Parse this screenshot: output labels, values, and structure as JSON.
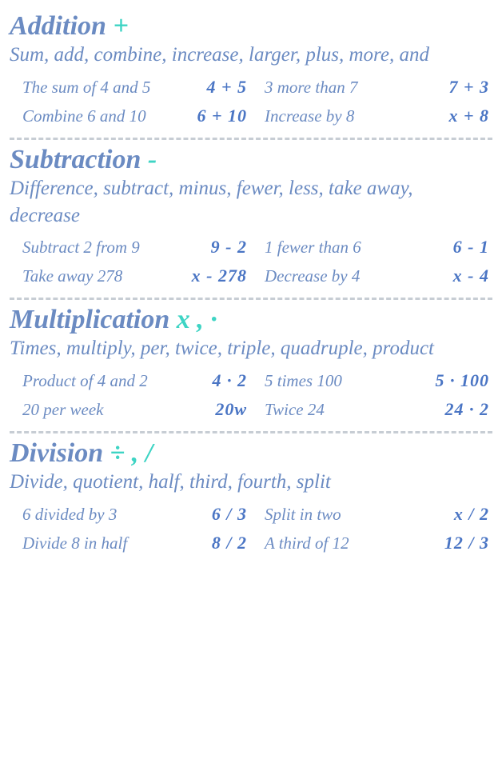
{
  "sections": [
    {
      "title": "Addition",
      "symbol": "+",
      "description": "Sum, add, combine, increase, larger, plus, more, and",
      "examples": [
        {
          "phrase": "The sum of 4 and 5",
          "expr": "4 + 5"
        },
        {
          "phrase": "3 more than 7",
          "expr": "7 + 3"
        },
        {
          "phrase": "Combine 6 and 10",
          "expr": "6 + 10"
        },
        {
          "phrase": "Increase by 8",
          "expr": "x + 8"
        }
      ]
    },
    {
      "title": "Subtraction",
      "symbol": "-",
      "description": "Difference, subtract, minus, fewer, less, take away, decrease",
      "examples": [
        {
          "phrase": "Subtract 2 from 9",
          "expr": "9 - 2"
        },
        {
          "phrase": "1 fewer than 6",
          "expr": "6 - 1"
        },
        {
          "phrase": "Take away 278",
          "expr": "x - 278"
        },
        {
          "phrase": "Decrease by 4",
          "expr": "x - 4"
        }
      ]
    },
    {
      "title": "Multiplication",
      "symbol": "x , ·",
      "description": "Times, multiply, per, twice, triple, quadruple, product",
      "examples": [
        {
          "phrase": "Product of 4 and 2",
          "expr": "4 · 2"
        },
        {
          "phrase": "5 times 100",
          "expr": "5 · 100"
        },
        {
          "phrase": "20 per week",
          "expr": "20w"
        },
        {
          "phrase": "Twice 24",
          "expr": "24 · 2"
        }
      ]
    },
    {
      "title": "Division",
      "symbol": "÷ , /",
      "description": "Divide, quotient, half, third, fourth, split",
      "examples": [
        {
          "phrase": "6 divided by 3",
          "expr": "6 / 3"
        },
        {
          "phrase": "Split in two",
          "expr": "x / 2"
        },
        {
          "phrase": "Divide 8 in half",
          "expr": "8 / 2"
        },
        {
          "phrase": "A third of 12",
          "expr": "12 / 3"
        }
      ]
    }
  ]
}
